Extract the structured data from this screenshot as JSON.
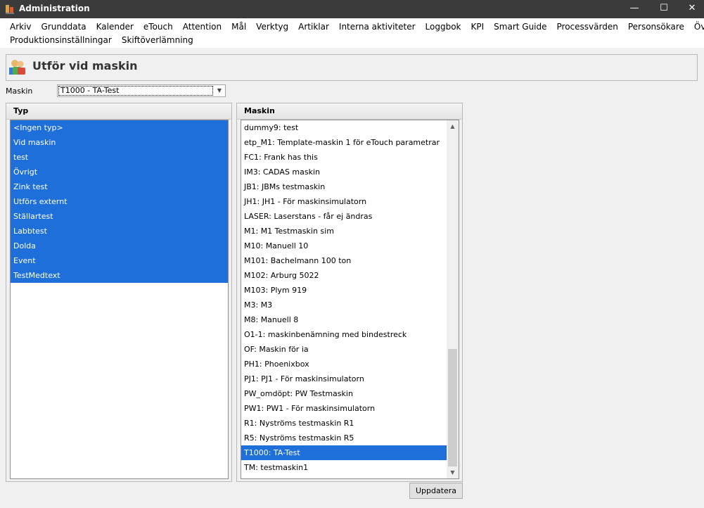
{
  "window": {
    "title": "Administration",
    "minimize_glyph": "—",
    "maximize_glyph": "☐",
    "close_glyph": "✕"
  },
  "menu": {
    "row1": [
      "Arkiv",
      "Grunddata",
      "Kalender",
      "eTouch",
      "Attention",
      "Mål",
      "Verktyg",
      "Artiklar",
      "Interna aktiviteter",
      "Loggbok",
      "KPI",
      "Smart Guide",
      "Processvärden",
      "Personsökare",
      "Övrigt"
    ],
    "row2": [
      "Produktionsinställningar",
      "Skiftöverlämning"
    ]
  },
  "header": {
    "title": "Utför vid maskin",
    "icon": "users-icon"
  },
  "maskin_filter": {
    "label": "Maskin",
    "selected": "T1000 - TA-Test",
    "arrow_glyph": "▼"
  },
  "typ_panel": {
    "header": "Typ",
    "items": [
      "<Ingen typ>",
      "Vid maskin",
      "test",
      "Övrigt",
      "Zink test",
      "Utförs externt",
      "Ställartest",
      "Labbtest",
      "Dolda",
      "Event",
      "TestMedtext"
    ],
    "selected_all": true
  },
  "maskin_panel": {
    "header": "Maskin",
    "items": [
      "dummy9: test",
      "etp_M1: Template-maskin 1 för eTouch parametrar",
      "FC1: Frank has this",
      "IM3: CADAS maskin",
      "JB1: JBMs testmaskin",
      "JH1: JH1 - För maskinsimulatorn",
      "LASER: Laserstans - får ej ändras",
      "M1: M1 Testmaskin sim",
      "M10: Manuell 10",
      "M101: Bachelmann 100 ton",
      "M102: Arburg 5022",
      "M103: Plym 919",
      "M3: M3",
      "M8: Manuell 8",
      "O1-1: maskinbenämning med bindestreck",
      "OF: Maskin för ia",
      "PH1: Phoenixbox",
      "PJ1: PJ1 - För maskinsimulatorn",
      "PW_omdöpt: PW Testmaskin",
      "PW1: PW1 - För maskinsimulatorn",
      "R1: Nyströms testmaskin R1",
      "R5: Nyströms testmaskin R5",
      "T1000: TA-Test",
      "TM: testmaskin1"
    ],
    "selected_index": 22,
    "scroll_up_glyph": "▲",
    "scroll_down_glyph": "▼"
  },
  "update_button": {
    "label": "Uppdatera"
  }
}
